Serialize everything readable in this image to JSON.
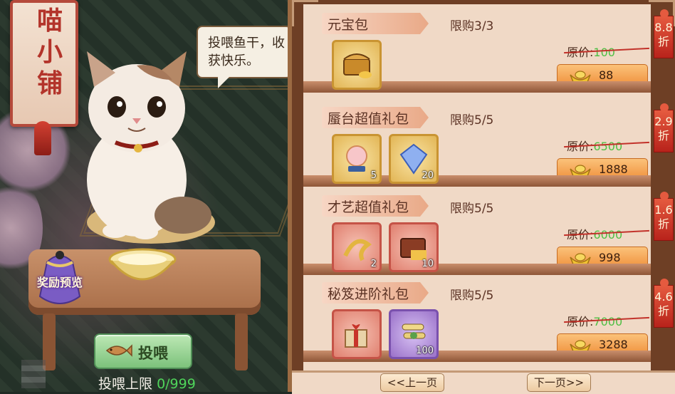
{
  "shop": {
    "banner_title": "喵小铺",
    "speech": "投喂鱼干，收获快乐。",
    "reward_preview": "奖励预览",
    "feed_button": "投喂",
    "feed_limit_label": "投喂上限",
    "feed_limit_value": "0/999"
  },
  "packs": [
    {
      "title": "元宝包",
      "limit": "限购3/3",
      "original_label": "原价:",
      "original_price": "100",
      "price": "88",
      "discount_value": "8.8",
      "discount_unit": "折",
      "items": [
        {
          "icon": "treasure-chest-icon",
          "frame": "gold",
          "count": ""
        }
      ]
    },
    {
      "title": "蜃台超值礼包",
      "limit": "限购5/5",
      "original_label": "原价:",
      "original_price": "6500",
      "price": "1888",
      "discount_value": "2.9",
      "discount_unit": "折",
      "items": [
        {
          "icon": "pearl-orb-icon",
          "frame": "gold",
          "count": "5"
        },
        {
          "icon": "blue-gem-icon",
          "frame": "gold",
          "count": "20"
        }
      ]
    },
    {
      "title": "才艺超值礼包",
      "limit": "限购5/5",
      "original_label": "原价:",
      "original_price": "6000",
      "price": "998",
      "discount_value": "1.6",
      "discount_unit": "折",
      "items": [
        {
          "icon": "golden-ribbon-icon",
          "frame": "red",
          "count": "2"
        },
        {
          "icon": "wooden-chest-icon",
          "frame": "red",
          "count": "10"
        }
      ]
    },
    {
      "title": "秘笈进阶礼包",
      "limit": "限购5/5",
      "original_label": "原价:",
      "original_price": "7000",
      "price": "3288",
      "discount_value": "4.6",
      "discount_unit": "折",
      "items": [
        {
          "icon": "gift-box-icon",
          "frame": "red",
          "count": ""
        },
        {
          "icon": "scroll-bundle-icon",
          "frame": "purple",
          "count": "100"
        }
      ]
    }
  ],
  "pager": {
    "prev": "<<上一页",
    "next": "下一页>>"
  },
  "colors": {
    "panel_bg": "#f0d9c6",
    "panel_frame": "#6e3f25",
    "price_button": "#ef8f3a",
    "discount_tag": "#c8291f",
    "original_price_green": "#4fbf44",
    "feed_button": "#7cc27b"
  }
}
